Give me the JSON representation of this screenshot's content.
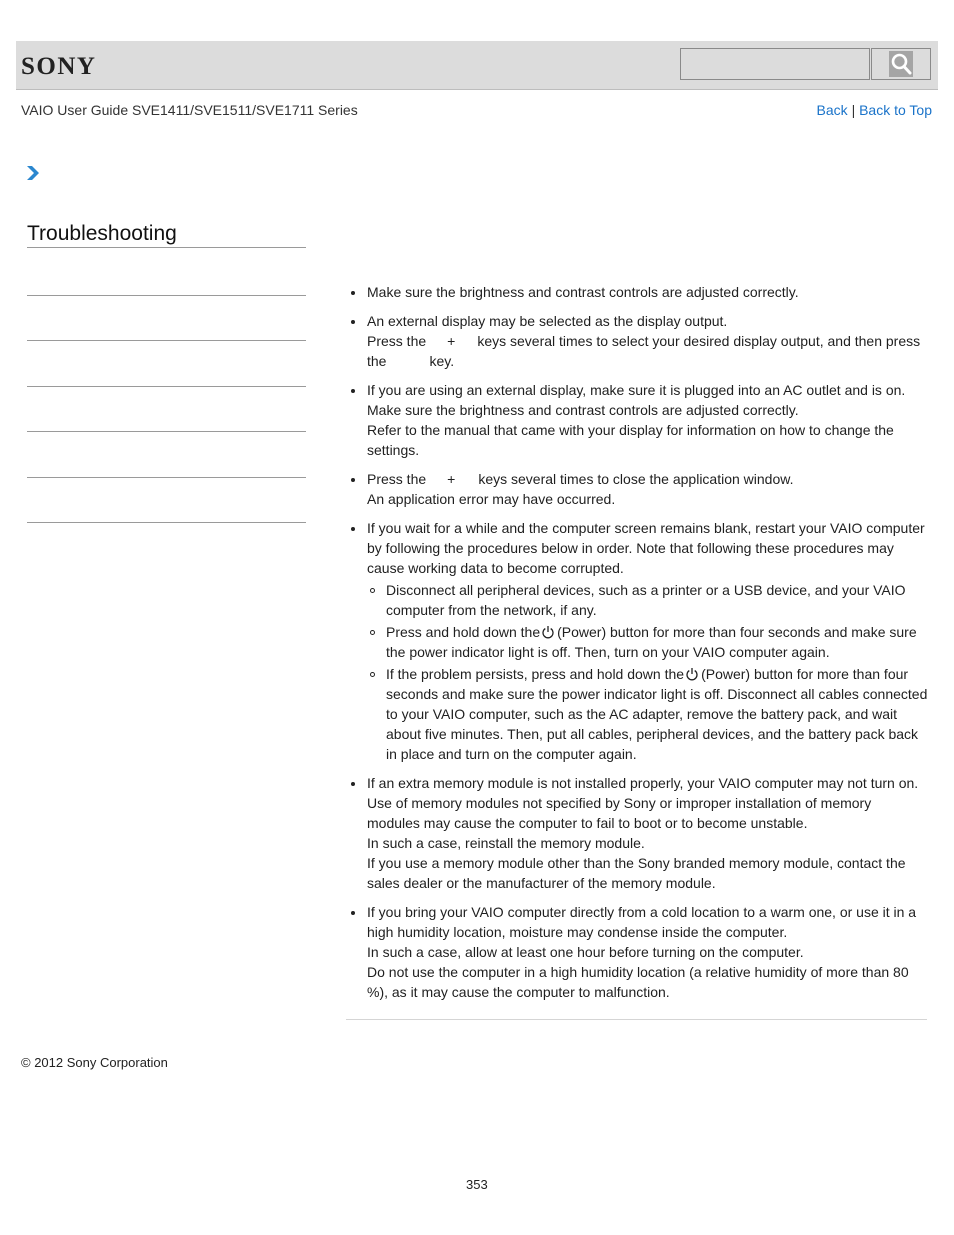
{
  "header": {
    "logo": "SONY",
    "search": {
      "placeholder": "",
      "value": ""
    },
    "search_button_icon": "search-icon"
  },
  "subheader": {
    "title": "VAIO User Guide SVE1411/SVE1511/SVE1711 Series",
    "back": "Back",
    "separator": "|",
    "back_to_top": "Back to Top"
  },
  "breadcrumb": {
    "icon": "chevron-right-icon",
    "label": ""
  },
  "sidebar": {
    "title": "Troubleshooting",
    "items": [
      "",
      "",
      "",
      "",
      "",
      ""
    ]
  },
  "content": {
    "items": [
      {
        "lines": [
          "Make sure the brightness and contrast controls are adjusted correctly."
        ]
      },
      {
        "line1": "An external display may be selected as the display output.",
        "line2_a": "Press the",
        "line2_plus": "+",
        "line2_b": "keys several times to select your desired display output, and then press",
        "line3_a": "the",
        "line3_b": "key."
      },
      {
        "lines": [
          "If you are using an external display, make sure it is plugged into an AC outlet and is on.",
          "Make sure the brightness and contrast controls are adjusted correctly.",
          "Refer to the manual that came with your display for information on how to change the settings."
        ]
      },
      {
        "line1_a": "Press the",
        "line1_plus": "+",
        "line1_b": "keys several times to close the application window.",
        "line2": "An application error may have occurred."
      },
      {
        "intro": "If you wait for a while and the computer screen remains blank, restart your VAIO computer by following the procedures below in order. Note that following these procedures may cause working data to become corrupted.",
        "sub": [
          {
            "text": "Disconnect all peripheral devices, such as a printer or a USB device, and your VAIO computer from the network, if any."
          },
          {
            "before": "Press and hold down the",
            "after": "(Power) button for more than four seconds and make sure the power indicator light is off. Then, turn on your VAIO computer again."
          },
          {
            "before": "If the problem persists, press and hold down the",
            "after": "(Power) button for more than four seconds and make sure the power indicator light is off. Disconnect all cables connected to your VAIO computer, such as the AC adapter, remove the battery pack, and wait about five minutes. Then, put all cables, peripheral devices, and the battery pack back in place and turn on the computer again."
          }
        ]
      },
      {
        "lines": [
          "If an extra memory module is not installed properly, your VAIO computer may not turn on.",
          "Use of memory modules not specified by Sony or improper installation of memory modules may cause the computer to fail to boot or to become unstable.",
          "In such a case, reinstall the memory module.",
          "If you use a memory module other than the Sony branded memory module, contact the sales dealer or the manufacturer of the memory module."
        ]
      },
      {
        "lines": [
          "If you bring your VAIO computer directly from a cold location to a warm one, or use it in a high humidity location, moisture may condense inside the computer.",
          "In such a case, allow at least one hour before turning on the computer.",
          "Do not use the computer in a high humidity location (a relative humidity of more than 80 %), as it may cause the computer to malfunction."
        ]
      }
    ]
  },
  "footer": {
    "copyright": "© 2012 Sony Corporation",
    "page_number": "353"
  },
  "colors": {
    "header_bg": "#dcdcdc",
    "link": "#1a73c9",
    "chevron": "#2b87cf"
  }
}
